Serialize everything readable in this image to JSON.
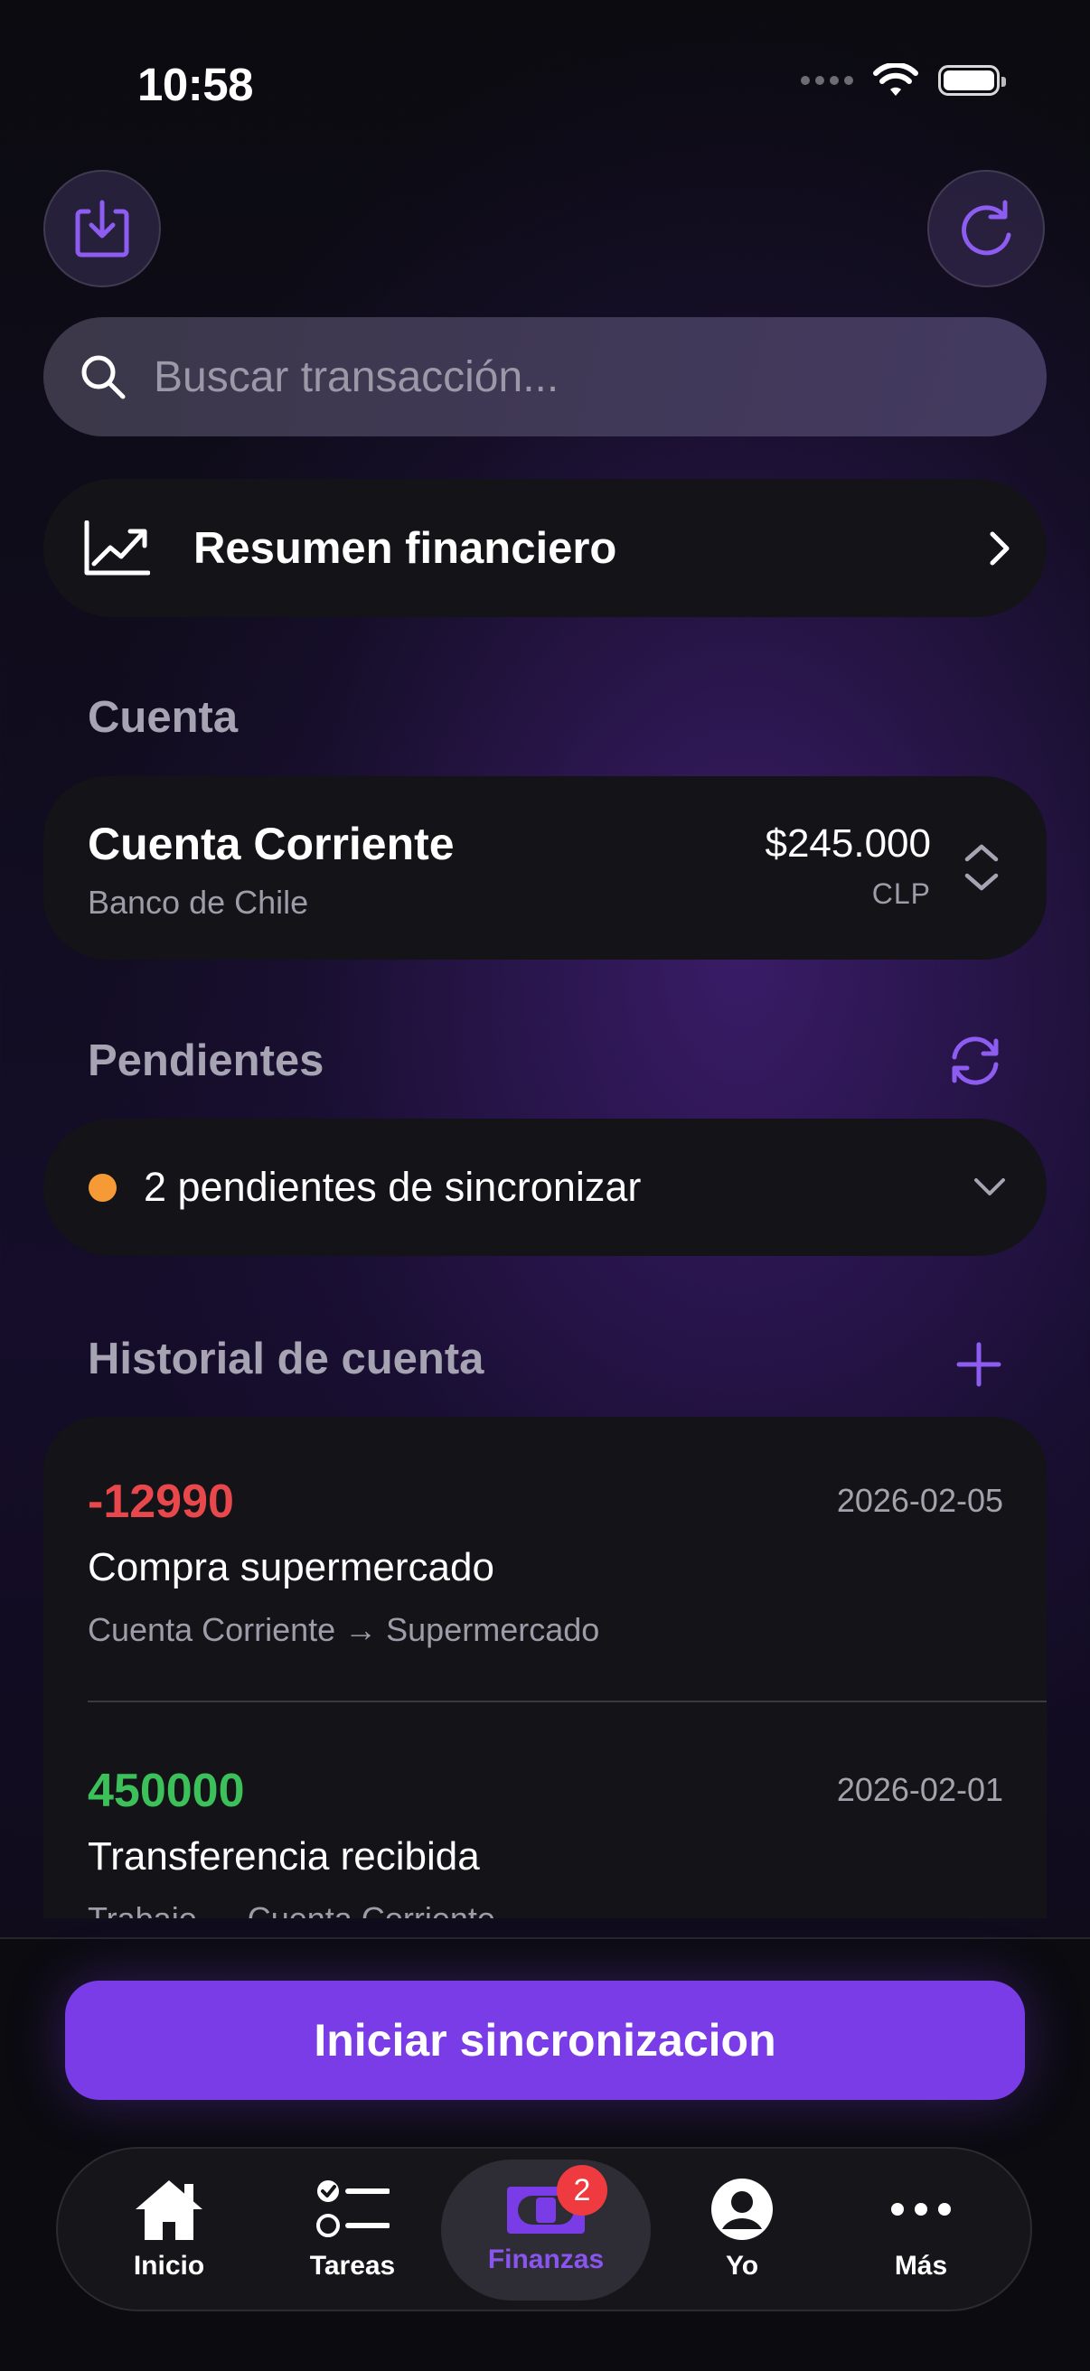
{
  "status_bar": {
    "time": "10:58"
  },
  "header": {
    "import_icon": "download-tray-icon",
    "refresh_icon": "refresh-icon"
  },
  "search": {
    "placeholder": "Buscar transacción..."
  },
  "summary": {
    "label": "Resumen financiero",
    "icon": "chart-trend-icon"
  },
  "account_section": {
    "title": "Cuenta",
    "name": "Cuenta Corriente",
    "bank": "Banco de Chile",
    "amount": "$245.000",
    "currency": "CLP"
  },
  "pending_section": {
    "title": "Pendientes",
    "text": "2 pendientes de sincronizar",
    "status_color": "#f59a35"
  },
  "history_section": {
    "title": "Historial de cuenta",
    "transactions": [
      {
        "amount": "-12990",
        "date": "2026-02-05",
        "title": "Compra supermercado",
        "route": "Cuenta Corriente → Supermercado",
        "amount_color": "#e8484b"
      },
      {
        "amount": "450000",
        "date": "2026-02-01",
        "title": "Transferencia recibida",
        "route": "Trabajo → Cuenta Corriente",
        "amount_color": "#3cc15a"
      }
    ]
  },
  "sync_button": {
    "label": "Iniciar sincronizacion"
  },
  "tabbar": {
    "items": [
      {
        "label": "Inicio",
        "icon": "home-icon"
      },
      {
        "label": "Tareas",
        "icon": "checklist-icon"
      },
      {
        "label": "Finanzas",
        "icon": "banknote-icon",
        "badge": "2",
        "active": true
      },
      {
        "label": "Yo",
        "icon": "profile-icon"
      },
      {
        "label": "Más",
        "icon": "more-icon"
      }
    ]
  },
  "colors": {
    "accent": "#7a3ce6",
    "accent_light": "#8d5cf0",
    "active_tab_text": "#8a54ee"
  }
}
